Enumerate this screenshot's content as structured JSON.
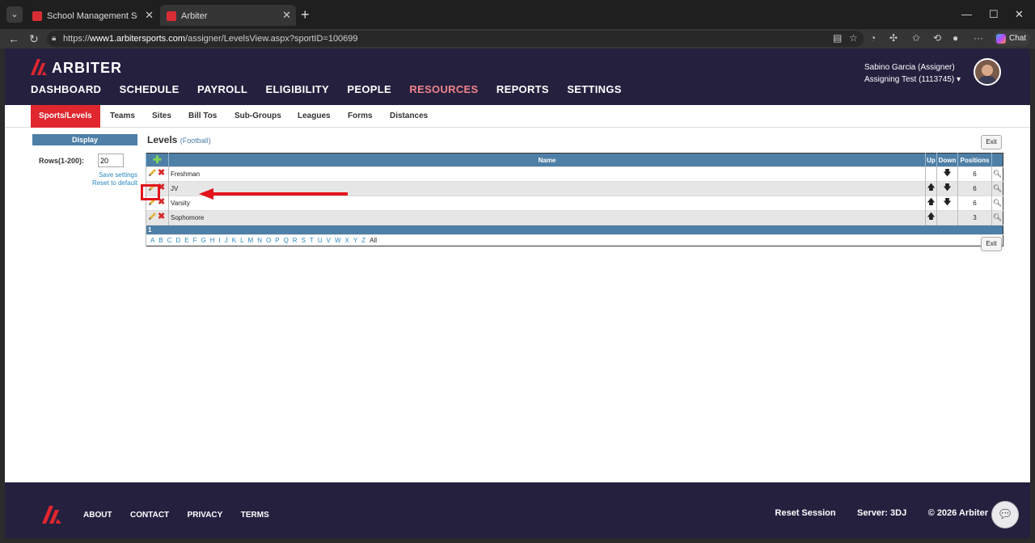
{
  "browser": {
    "tabs": [
      {
        "title": "School Management Software for"
      },
      {
        "title": "Arbiter"
      }
    ],
    "url_prefix": "https://",
    "url_host": "www1.arbitersports.com",
    "url_path": "/assigner/LevelsView.aspx?sportID=100699",
    "chat_label": "Chat"
  },
  "header": {
    "brand": "ARBITER",
    "nav": [
      "DASHBOARD",
      "SCHEDULE",
      "PAYROLL",
      "ELIGIBILITY",
      "PEOPLE",
      "RESOURCES",
      "REPORTS",
      "SETTINGS"
    ],
    "active_nav": "RESOURCES",
    "user_name": "Sabino Garcia (Assigner)",
    "account": "Assigning Test (1113745)"
  },
  "subnav": [
    "Sports/Levels",
    "Teams",
    "Sites",
    "Bill Tos",
    "Sub-Groups",
    "Leagues",
    "Forms",
    "Distances"
  ],
  "display_panel": {
    "title": "Display",
    "rows_label": "Rows(1-200):",
    "rows_value": "20",
    "save_settings": "Save settings",
    "reset_default": "Reset to default"
  },
  "levels": {
    "title": "Levels",
    "sport": "(Football)",
    "exit_label": "Exit",
    "columns": {
      "name": "Name",
      "up": "Up",
      "down": "Down",
      "positions": "Positions"
    },
    "rows": [
      {
        "name": "Freshman",
        "positions": "6",
        "up": false,
        "down": true
      },
      {
        "name": "JV",
        "positions": "6",
        "up": true,
        "down": true
      },
      {
        "name": "Varsity",
        "positions": "6",
        "up": true,
        "down": true
      },
      {
        "name": "Sophomore",
        "positions": "3",
        "up": true,
        "down": false
      }
    ],
    "page": "1",
    "letters": [
      "A",
      "B",
      "C",
      "D",
      "E",
      "F",
      "G",
      "H",
      "I",
      "J",
      "K",
      "L",
      "M",
      "N",
      "O",
      "P",
      "Q",
      "R",
      "S",
      "T",
      "U",
      "V",
      "W",
      "X",
      "Y",
      "Z"
    ],
    "all_label": "All"
  },
  "footer": {
    "links": [
      "ABOUT",
      "CONTACT",
      "PRIVACY",
      "TERMS"
    ],
    "reset_session": "Reset Session",
    "server": "Server: 3DJ",
    "copyright": "© 2026 Arbiter"
  },
  "colors": {
    "header_bg": "#26203f",
    "accent_red": "#e0262f",
    "table_blue": "#4e7fa6",
    "link_blue": "#2a8abf"
  }
}
